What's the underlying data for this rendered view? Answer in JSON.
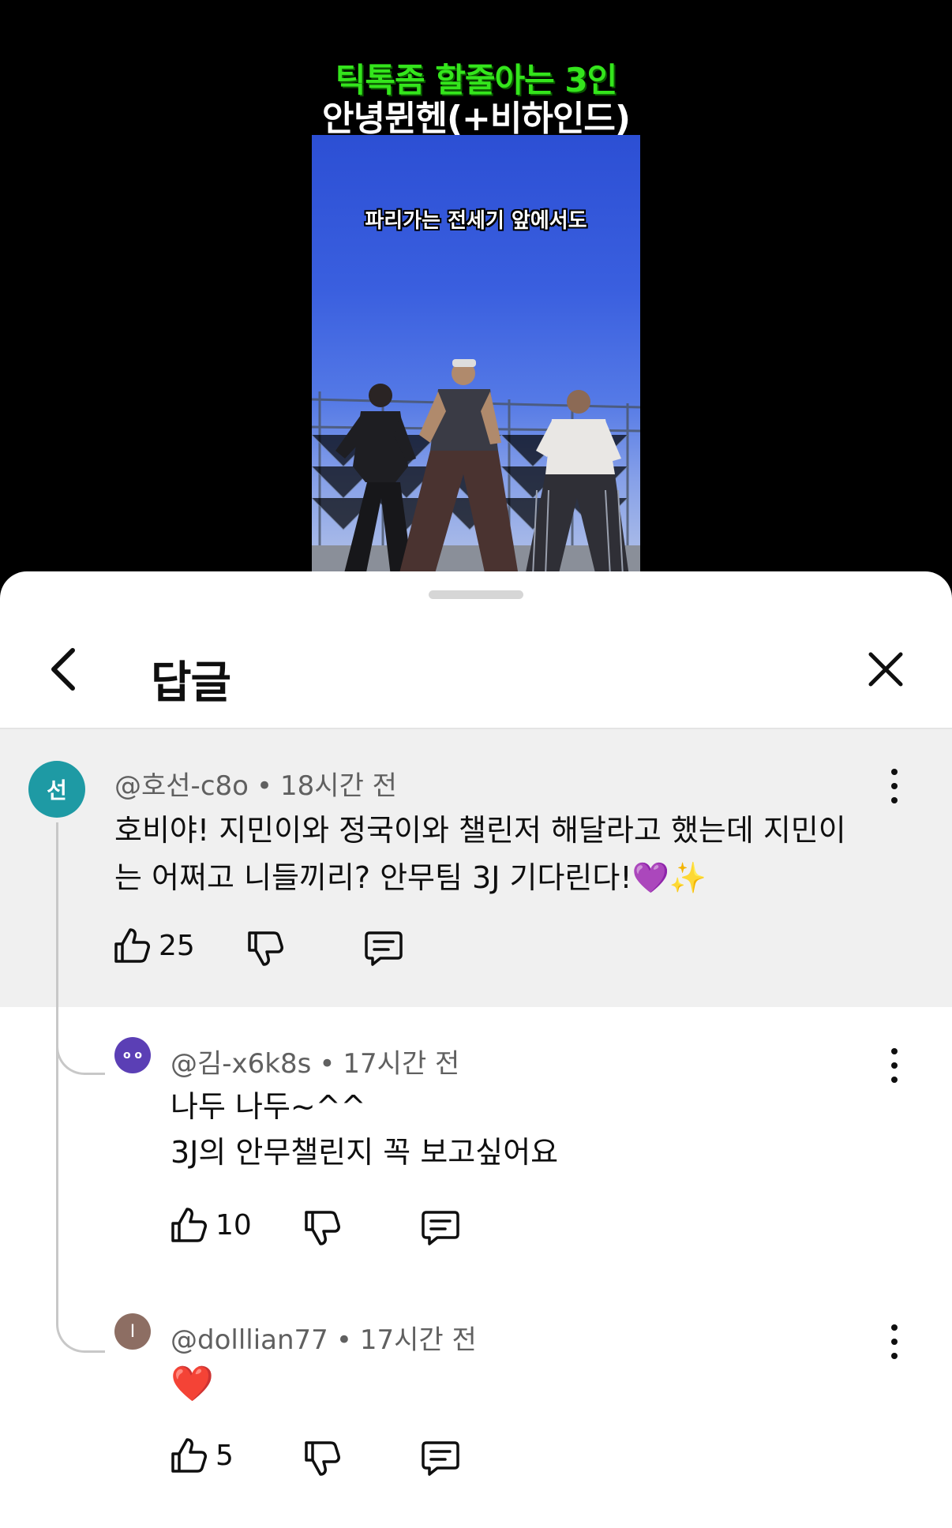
{
  "video": {
    "title_line1": "틱톡좀 할줄아는 3인",
    "title_line2": "안녕뮌헨(+비하인드)",
    "subtitle": "파리가는 전세기 앞에서도"
  },
  "sheet": {
    "title": "답글",
    "back_icon": "chevron-left-icon",
    "close_icon": "close-icon"
  },
  "comments": [
    {
      "avatar_letter": "선",
      "avatar_color": "#1e9aa4",
      "handle": "@호선-c8o",
      "time": "18시간 전",
      "text": "호비야! 지민이와 정국이와 챌린저 해달라고 했는데 지민이는 어쩌고 니들끼리? 안무팀 3J 기다린다!💜✨",
      "likes": "25"
    },
    {
      "avatar_letter": "o o",
      "avatar_color": "#5b3fb5",
      "handle": "@김-x6k8s",
      "time": "17시간 전",
      "text_line1": "나두 나두~^^",
      "text_line2": "3J의 안무챌린지 꼭 보고싶어요",
      "likes": "10"
    },
    {
      "avatar_letter": "I",
      "avatar_color": "#8d6e63",
      "handle": "@dolllian77",
      "time": "17시간 전",
      "text": "❤️",
      "likes": "5"
    }
  ],
  "icons": {
    "like": "thumbs-up-icon",
    "dislike": "thumbs-down-icon",
    "reply": "reply-comment-icon",
    "more": "more-vertical-icon"
  },
  "colors": {
    "title_green": "#34e51c",
    "parent_bg": "#f0f0f0"
  }
}
